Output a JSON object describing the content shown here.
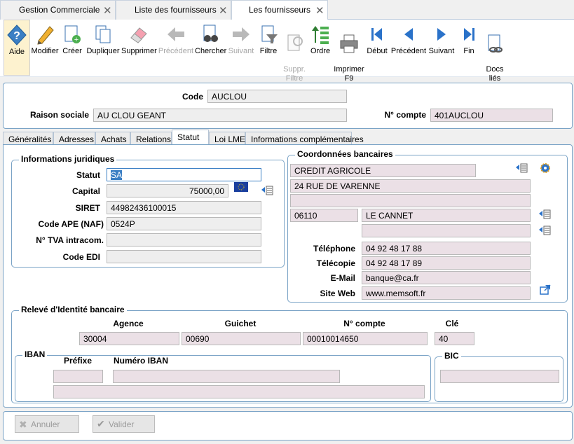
{
  "doc_tabs": [
    {
      "label": "Gestion Commerciale"
    },
    {
      "label": "Liste des fournisseurs"
    },
    {
      "label": "Les fournisseurs"
    }
  ],
  "toolbar": {
    "aide": "Aide",
    "modifier": "Modifier",
    "creer": "Créer",
    "dupliquer": "Dupliquer",
    "supprimer": "Supprimer",
    "precedent_dis": "Précédent",
    "chercher": "Chercher",
    "suivant_dis": "Suivant",
    "filtre": "Filtre",
    "suppr_filtre": "Suppr.\nFiltre",
    "ordre": "Ordre",
    "imprimer": "Imprimer\nF9",
    "debut": "Début",
    "precedent": "Précédent",
    "suivant": "Suivant",
    "fin": "Fin",
    "docs_lies": "Docs\nliés"
  },
  "header": {
    "code_label": "Code",
    "code": "AUCLOU",
    "raison_label": "Raison sociale",
    "raison": "AU CLOU GEANT",
    "compte_label": "N° compte",
    "compte": "401AUCLOU"
  },
  "subtabs": [
    "Généralités",
    "Adresses",
    "Achats",
    "Relations",
    "Statut",
    "Loi LME",
    "Informations complémentaires"
  ],
  "juridique": {
    "title": "Informations juridiques",
    "statut_label": "Statut",
    "statut": "SA",
    "capital_label": "Capital",
    "capital": "75000,00",
    "siret_label": "SIRET",
    "siret": "44982436100015",
    "ape_label": "Code APE (NAF)",
    "ape": "0524P",
    "tva_label": "N° TVA intracom.",
    "tva": "",
    "edi_label": "Code EDI",
    "edi": ""
  },
  "bancaires": {
    "title": "Coordonnées bancaires",
    "banque": "CREDIT AGRICOLE",
    "adresse1": "24 RUE DE VARENNE",
    "adresse2": "",
    "cp": "06110",
    "ville": "LE CANNET",
    "ville2": "",
    "tel_label": "Téléphone",
    "tel": "04 92 48 17 88",
    "fax_label": "Télécopie",
    "fax": "04 92 48 17 89",
    "mail_label": "E-Mail",
    "mail": "banque@ca.fr",
    "web_label": "Site Web",
    "web": "www.memsoft.fr"
  },
  "rib": {
    "title": "Relevé d'Identité bancaire",
    "agence_label": "Agence",
    "agence": "30004",
    "guichet_label": "Guichet",
    "guichet": "00690",
    "compte_label": "N° compte",
    "compte": "00010014650",
    "cle_label": "Clé",
    "cle": "40",
    "iban_title": "IBAN",
    "prefixe_label": "Préfixe",
    "numero_label": "Numéro IBAN",
    "bic_title": "BIC"
  },
  "footer": {
    "annuler": "Annuler",
    "valider": "Valider"
  }
}
